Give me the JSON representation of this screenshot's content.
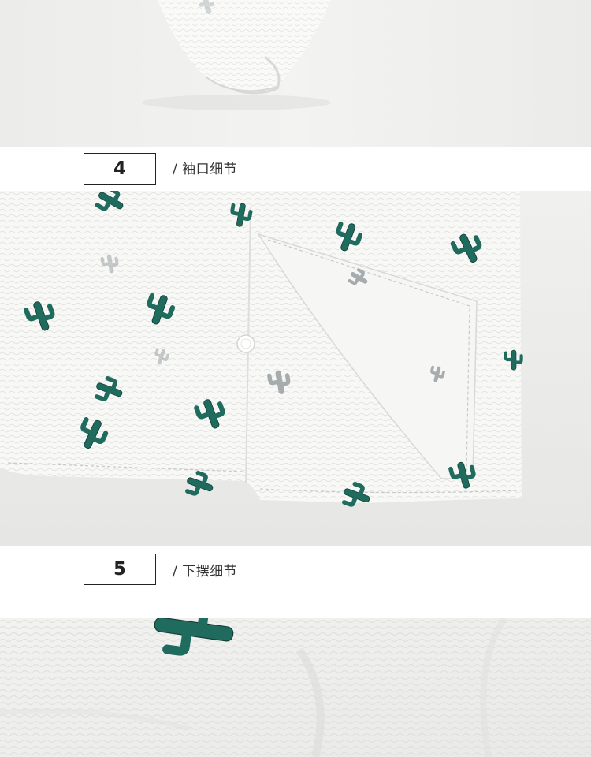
{
  "sections": [
    {
      "number": "4",
      "caption": "/ 袖口细节"
    },
    {
      "number": "5",
      "caption": "/ 下摆细节"
    }
  ],
  "colors": {
    "cactus": "#1f6b5e",
    "cactus_faded": "#a9aeb0",
    "fabric": "#f4f4f2",
    "background": "#ffffff",
    "box_border": "#222222"
  },
  "icons": [
    "cactus-print-icon"
  ]
}
